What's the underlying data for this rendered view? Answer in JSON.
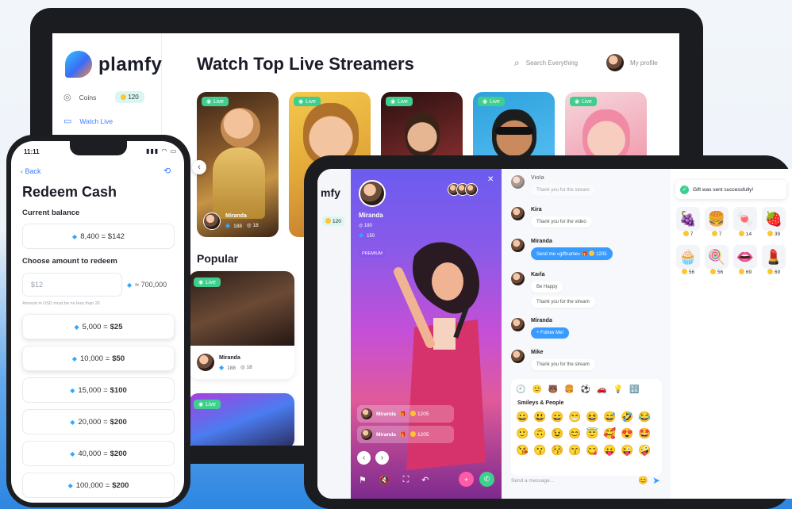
{
  "laptop": {
    "brand": "plamfy",
    "sidebar": {
      "coins_label": "Coins",
      "coins_count": "120",
      "watch_live": "Watch Live"
    },
    "title": "Watch Top Live Streamers",
    "search_placeholder": "Search Everything",
    "profile_label": "My profile",
    "live_badge": "Live",
    "streamer": {
      "name": "Miranda",
      "diamonds": "188",
      "viewers": "18"
    },
    "popular_title": "Popular",
    "popular_streamer": {
      "name": "Miranda",
      "diamonds": "188",
      "viewers": "18"
    },
    "nav_prev": "‹"
  },
  "phone": {
    "time": "11:11",
    "status": "▮▮▮ ◠ ▭",
    "back": "Back",
    "title": "Redeem Cash",
    "balance_label": "Current balance",
    "balance": "8,400 = $142",
    "choose_label": "Choose amount to redeem",
    "input_placeholder": "$12",
    "converted": "≈ 700,000",
    "hint": "Amount in USD must be no less than 25",
    "options": [
      {
        "diamonds": "5,000 =",
        "cash": "$25"
      },
      {
        "diamonds": "10,000 =",
        "cash": "$50"
      },
      {
        "diamonds": "15,000 =",
        "cash": "$100"
      },
      {
        "diamonds": "20,000 =",
        "cash": "$200"
      },
      {
        "diamonds": "40,000 =",
        "cash": "$200"
      },
      {
        "diamonds": "100,000 =",
        "cash": "$200"
      }
    ]
  },
  "tablet": {
    "brand_partial": "mfy",
    "coins_partial": "120",
    "streamer": {
      "name": "Miranda",
      "stat1": "180",
      "stat2": "150",
      "badge": "PREMIUM"
    },
    "close": "✕",
    "mini_chats": [
      {
        "name": "Miranda",
        "coins": "1205"
      },
      {
        "name": "Miranda",
        "coins": "1205"
      }
    ],
    "chat": [
      {
        "name": "Viola",
        "text": "Thank you for the stream"
      },
      {
        "name": "Kira",
        "text": "Thank you for the video"
      },
      {
        "name": "Miranda",
        "text": "Send me «giftname»",
        "coins": "1205"
      },
      {
        "name": "Karla",
        "text": "Be Happy",
        "text2": "Thank you for the stream"
      },
      {
        "name": "Miranda",
        "text": "Follow Me!"
      },
      {
        "name": "Mike",
        "text": "Thank you for the stream"
      }
    ],
    "emoji_title": "Smileys & People",
    "emoji_tabs": [
      "🕘",
      "🙂",
      "🐻",
      "🍔",
      "⚽",
      "🚗",
      "💡",
      "🔣"
    ],
    "emojis": [
      "😀",
      "😃",
      "😄",
      "😁",
      "😆",
      "😅",
      "🤣",
      "😂",
      "🙂",
      "🙃",
      "😉",
      "😊",
      "😇",
      "🥰",
      "😍",
      "🤩",
      "😘",
      "😗",
      "😚",
      "😙",
      "😋",
      "😛",
      "😜",
      "🤪"
    ],
    "send_placeholder": "Send a message...",
    "toast": "Gift was sent successfully!",
    "gifts": [
      {
        "icon": "🍇",
        "price": "7"
      },
      {
        "icon": "🍔",
        "price": "7"
      },
      {
        "icon": "🍬",
        "price": "14"
      },
      {
        "icon": "🍓",
        "price": "39"
      },
      {
        "icon": "🧁",
        "price": "56"
      },
      {
        "icon": "🍭",
        "price": "56"
      },
      {
        "icon": "👄",
        "price": "69"
      },
      {
        "icon": "💄",
        "price": "69"
      }
    ]
  },
  "colors": {
    "accent": "#3a7bff",
    "live": "#3ecf8e",
    "coin": "#ffc531",
    "diamond": "#2fa7ff"
  }
}
